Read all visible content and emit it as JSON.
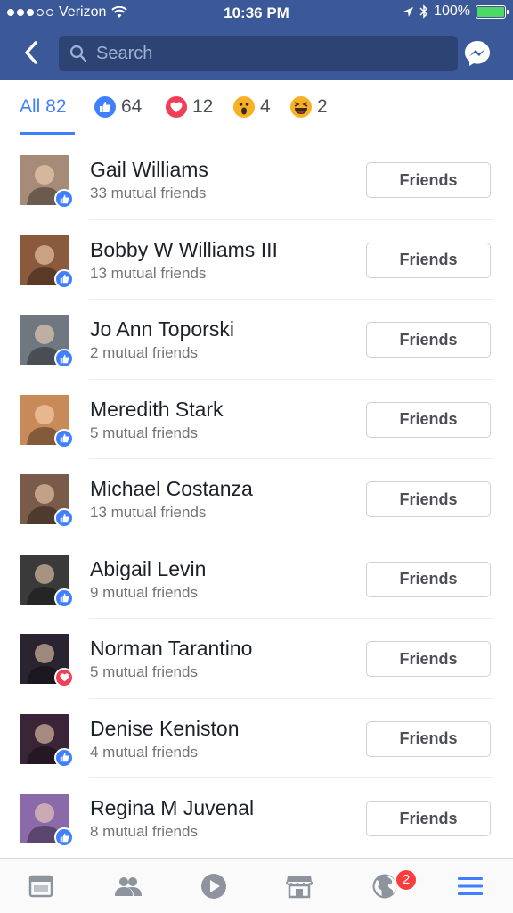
{
  "status_bar": {
    "carrier": "Verizon",
    "time": "10:36 PM",
    "battery": "100%",
    "battery_level": 1.0,
    "signal_dots_filled": 3,
    "signal_dots_total": 5
  },
  "header": {
    "search_placeholder": "Search",
    "back_icon": "chevron-left-icon",
    "messenger_icon": "messenger-icon"
  },
  "tabs": [
    {
      "label": "All 82",
      "icon": null,
      "active": true
    },
    {
      "label": "64",
      "icon": "like-icon"
    },
    {
      "label": "12",
      "icon": "love-icon"
    },
    {
      "label": "4",
      "icon": "wow-icon"
    },
    {
      "label": "2",
      "icon": "haha-icon"
    }
  ],
  "people": [
    {
      "name": "Gail Williams",
      "mutual": "33 mutual friends",
      "reaction": "like",
      "button": "Friends",
      "avatar_color": "#a58b78"
    },
    {
      "name": "Bobby W Williams III",
      "mutual": "13 mutual friends",
      "reaction": "like",
      "button": "Friends",
      "avatar_color": "#8a5a3c"
    },
    {
      "name": "Jo Ann Toporski",
      "mutual": "2 mutual friends",
      "reaction": "like",
      "button": "Friends",
      "avatar_color": "#6f7880"
    },
    {
      "name": "Meredith Stark",
      "mutual": "5 mutual friends",
      "reaction": "like",
      "button": "Friends",
      "avatar_color": "#c98a5a"
    },
    {
      "name": "Michael Costanza",
      "mutual": "13 mutual friends",
      "reaction": "like",
      "button": "Friends",
      "avatar_color": "#7a5a48"
    },
    {
      "name": "Abigail Levin",
      "mutual": "9 mutual friends",
      "reaction": "like",
      "button": "Friends",
      "avatar_color": "#3a3a3a"
    },
    {
      "name": "Norman Tarantino",
      "mutual": "5 mutual friends",
      "reaction": "love",
      "button": "Friends",
      "avatar_color": "#2a2430"
    },
    {
      "name": "Denise Keniston",
      "mutual": "4 mutual friends",
      "reaction": "like",
      "button": "Friends",
      "avatar_color": "#3a2438"
    },
    {
      "name": "Regina M Juvenal",
      "mutual": "8 mutual friends",
      "reaction": "like",
      "button": "Friends",
      "avatar_color": "#8a6aa8"
    }
  ],
  "bottom_nav": {
    "items": [
      "news-feed-icon",
      "friends-icon",
      "video-icon",
      "marketplace-icon",
      "notifications-globe-icon",
      "menu-icon"
    ],
    "notification_count": "2",
    "active": "menu-icon"
  },
  "colors": {
    "header_blue": "#3b5998",
    "accent": "#4080ff",
    "love": "#f33e58",
    "badge_red": "#fa3e3e"
  }
}
